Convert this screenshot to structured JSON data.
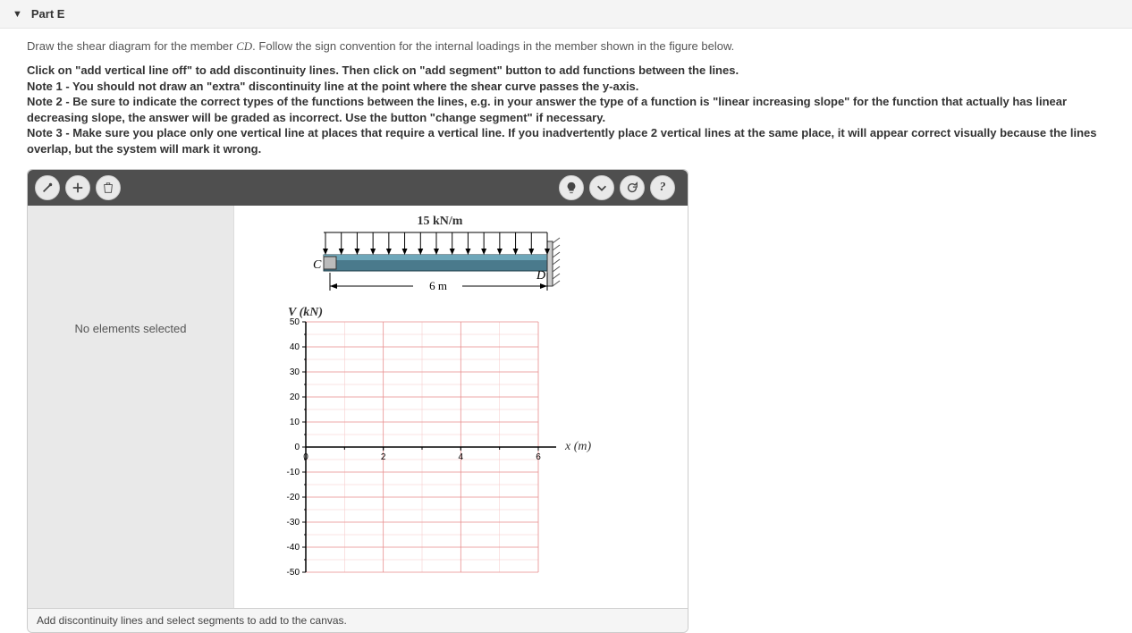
{
  "header": {
    "part_label": "Part E"
  },
  "prompt": {
    "pre": "Draw the shear diagram for the member ",
    "member": "CD",
    "post": ". Follow the sign convention for the internal loadings in the member shown in the figure below."
  },
  "notes": {
    "line1": "Click on \"add vertical line off\" to add discontinuity lines. Then click on \"add segment\" button to add functions between the lines.",
    "line2": "Note 1 - You should not draw an \"extra\" discontinuity line at the point where the shear curve passes the y-axis.",
    "line3": "Note 2 - Be sure to indicate the correct types of the functions between the lines, e.g. in your answer the type of a function is \"linear increasing slope\" for the function that actually has linear decreasing slope, the answer will be graded as incorrect. Use the button \"change segment\" if necessary.",
    "line4": "Note 3 - Make sure you place only one vertical line at places that require a vertical line. If you inadvertently place 2 vertical lines at the same place, it will appear correct visually because the lines overlap, but the system will mark it wrong."
  },
  "toolbar": {
    "add_line_icon": "add-vertical-line",
    "add_segment_icon": "plus-icon",
    "delete_icon": "trash-icon",
    "hint_icon": "bulb-icon",
    "collapse_icon": "chevron-down-icon",
    "reset_icon": "refresh-icon",
    "help_icon": "question-icon"
  },
  "selection_panel": {
    "message": "No elements selected"
  },
  "beam_figure": {
    "load_label": "15 kN/m",
    "left_label": "C",
    "right_label": "D",
    "span_label": "6 m"
  },
  "chart_data": {
    "type": "line",
    "title": "",
    "ylabel": "V (kN)",
    "xlabel": "x (m)",
    "xlim": [
      0,
      6
    ],
    "ylim": [
      -50,
      50
    ],
    "y_ticks": [
      50,
      40,
      30,
      20,
      10,
      0,
      -10,
      -20,
      -30,
      -40,
      -50
    ],
    "x_ticks": [
      0,
      2,
      4,
      6
    ],
    "x_minor_step": 1,
    "y_minor_step": 5,
    "series": []
  },
  "status": {
    "message": "Add discontinuity lines and select segments to add to the canvas."
  }
}
